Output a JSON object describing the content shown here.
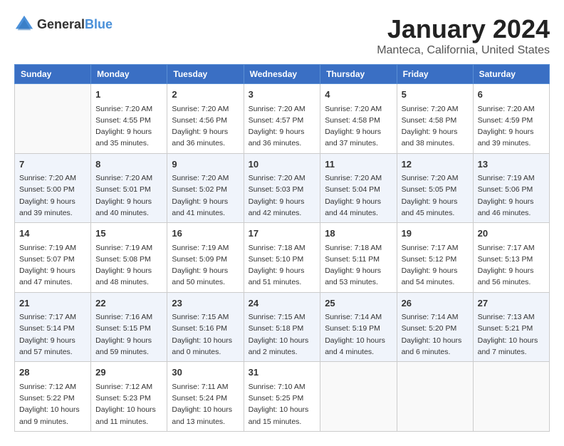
{
  "header": {
    "logo_general": "General",
    "logo_blue": "Blue",
    "month_year": "January 2024",
    "location": "Manteca, California, United States"
  },
  "days_of_week": [
    "Sunday",
    "Monday",
    "Tuesday",
    "Wednesday",
    "Thursday",
    "Friday",
    "Saturday"
  ],
  "weeks": [
    [
      {
        "day": "",
        "sunrise": "",
        "sunset": "",
        "daylight": ""
      },
      {
        "day": "1",
        "sunrise": "Sunrise: 7:20 AM",
        "sunset": "Sunset: 4:55 PM",
        "daylight": "Daylight: 9 hours and 35 minutes."
      },
      {
        "day": "2",
        "sunrise": "Sunrise: 7:20 AM",
        "sunset": "Sunset: 4:56 PM",
        "daylight": "Daylight: 9 hours and 36 minutes."
      },
      {
        "day": "3",
        "sunrise": "Sunrise: 7:20 AM",
        "sunset": "Sunset: 4:57 PM",
        "daylight": "Daylight: 9 hours and 36 minutes."
      },
      {
        "day": "4",
        "sunrise": "Sunrise: 7:20 AM",
        "sunset": "Sunset: 4:58 PM",
        "daylight": "Daylight: 9 hours and 37 minutes."
      },
      {
        "day": "5",
        "sunrise": "Sunrise: 7:20 AM",
        "sunset": "Sunset: 4:58 PM",
        "daylight": "Daylight: 9 hours and 38 minutes."
      },
      {
        "day": "6",
        "sunrise": "Sunrise: 7:20 AM",
        "sunset": "Sunset: 4:59 PM",
        "daylight": "Daylight: 9 hours and 39 minutes."
      }
    ],
    [
      {
        "day": "7",
        "sunrise": "Sunrise: 7:20 AM",
        "sunset": "Sunset: 5:00 PM",
        "daylight": "Daylight: 9 hours and 39 minutes."
      },
      {
        "day": "8",
        "sunrise": "Sunrise: 7:20 AM",
        "sunset": "Sunset: 5:01 PM",
        "daylight": "Daylight: 9 hours and 40 minutes."
      },
      {
        "day": "9",
        "sunrise": "Sunrise: 7:20 AM",
        "sunset": "Sunset: 5:02 PM",
        "daylight": "Daylight: 9 hours and 41 minutes."
      },
      {
        "day": "10",
        "sunrise": "Sunrise: 7:20 AM",
        "sunset": "Sunset: 5:03 PM",
        "daylight": "Daylight: 9 hours and 42 minutes."
      },
      {
        "day": "11",
        "sunrise": "Sunrise: 7:20 AM",
        "sunset": "Sunset: 5:04 PM",
        "daylight": "Daylight: 9 hours and 44 minutes."
      },
      {
        "day": "12",
        "sunrise": "Sunrise: 7:20 AM",
        "sunset": "Sunset: 5:05 PM",
        "daylight": "Daylight: 9 hours and 45 minutes."
      },
      {
        "day": "13",
        "sunrise": "Sunrise: 7:19 AM",
        "sunset": "Sunset: 5:06 PM",
        "daylight": "Daylight: 9 hours and 46 minutes."
      }
    ],
    [
      {
        "day": "14",
        "sunrise": "Sunrise: 7:19 AM",
        "sunset": "Sunset: 5:07 PM",
        "daylight": "Daylight: 9 hours and 47 minutes."
      },
      {
        "day": "15",
        "sunrise": "Sunrise: 7:19 AM",
        "sunset": "Sunset: 5:08 PM",
        "daylight": "Daylight: 9 hours and 48 minutes."
      },
      {
        "day": "16",
        "sunrise": "Sunrise: 7:19 AM",
        "sunset": "Sunset: 5:09 PM",
        "daylight": "Daylight: 9 hours and 50 minutes."
      },
      {
        "day": "17",
        "sunrise": "Sunrise: 7:18 AM",
        "sunset": "Sunset: 5:10 PM",
        "daylight": "Daylight: 9 hours and 51 minutes."
      },
      {
        "day": "18",
        "sunrise": "Sunrise: 7:18 AM",
        "sunset": "Sunset: 5:11 PM",
        "daylight": "Daylight: 9 hours and 53 minutes."
      },
      {
        "day": "19",
        "sunrise": "Sunrise: 7:17 AM",
        "sunset": "Sunset: 5:12 PM",
        "daylight": "Daylight: 9 hours and 54 minutes."
      },
      {
        "day": "20",
        "sunrise": "Sunrise: 7:17 AM",
        "sunset": "Sunset: 5:13 PM",
        "daylight": "Daylight: 9 hours and 56 minutes."
      }
    ],
    [
      {
        "day": "21",
        "sunrise": "Sunrise: 7:17 AM",
        "sunset": "Sunset: 5:14 PM",
        "daylight": "Daylight: 9 hours and 57 minutes."
      },
      {
        "day": "22",
        "sunrise": "Sunrise: 7:16 AM",
        "sunset": "Sunset: 5:15 PM",
        "daylight": "Daylight: 9 hours and 59 minutes."
      },
      {
        "day": "23",
        "sunrise": "Sunrise: 7:15 AM",
        "sunset": "Sunset: 5:16 PM",
        "daylight": "Daylight: 10 hours and 0 minutes."
      },
      {
        "day": "24",
        "sunrise": "Sunrise: 7:15 AM",
        "sunset": "Sunset: 5:18 PM",
        "daylight": "Daylight: 10 hours and 2 minutes."
      },
      {
        "day": "25",
        "sunrise": "Sunrise: 7:14 AM",
        "sunset": "Sunset: 5:19 PM",
        "daylight": "Daylight: 10 hours and 4 minutes."
      },
      {
        "day": "26",
        "sunrise": "Sunrise: 7:14 AM",
        "sunset": "Sunset: 5:20 PM",
        "daylight": "Daylight: 10 hours and 6 minutes."
      },
      {
        "day": "27",
        "sunrise": "Sunrise: 7:13 AM",
        "sunset": "Sunset: 5:21 PM",
        "daylight": "Daylight: 10 hours and 7 minutes."
      }
    ],
    [
      {
        "day": "28",
        "sunrise": "Sunrise: 7:12 AM",
        "sunset": "Sunset: 5:22 PM",
        "daylight": "Daylight: 10 hours and 9 minutes."
      },
      {
        "day": "29",
        "sunrise": "Sunrise: 7:12 AM",
        "sunset": "Sunset: 5:23 PM",
        "daylight": "Daylight: 10 hours and 11 minutes."
      },
      {
        "day": "30",
        "sunrise": "Sunrise: 7:11 AM",
        "sunset": "Sunset: 5:24 PM",
        "daylight": "Daylight: 10 hours and 13 minutes."
      },
      {
        "day": "31",
        "sunrise": "Sunrise: 7:10 AM",
        "sunset": "Sunset: 5:25 PM",
        "daylight": "Daylight: 10 hours and 15 minutes."
      },
      {
        "day": "",
        "sunrise": "",
        "sunset": "",
        "daylight": ""
      },
      {
        "day": "",
        "sunrise": "",
        "sunset": "",
        "daylight": ""
      },
      {
        "day": "",
        "sunrise": "",
        "sunset": "",
        "daylight": ""
      }
    ]
  ]
}
